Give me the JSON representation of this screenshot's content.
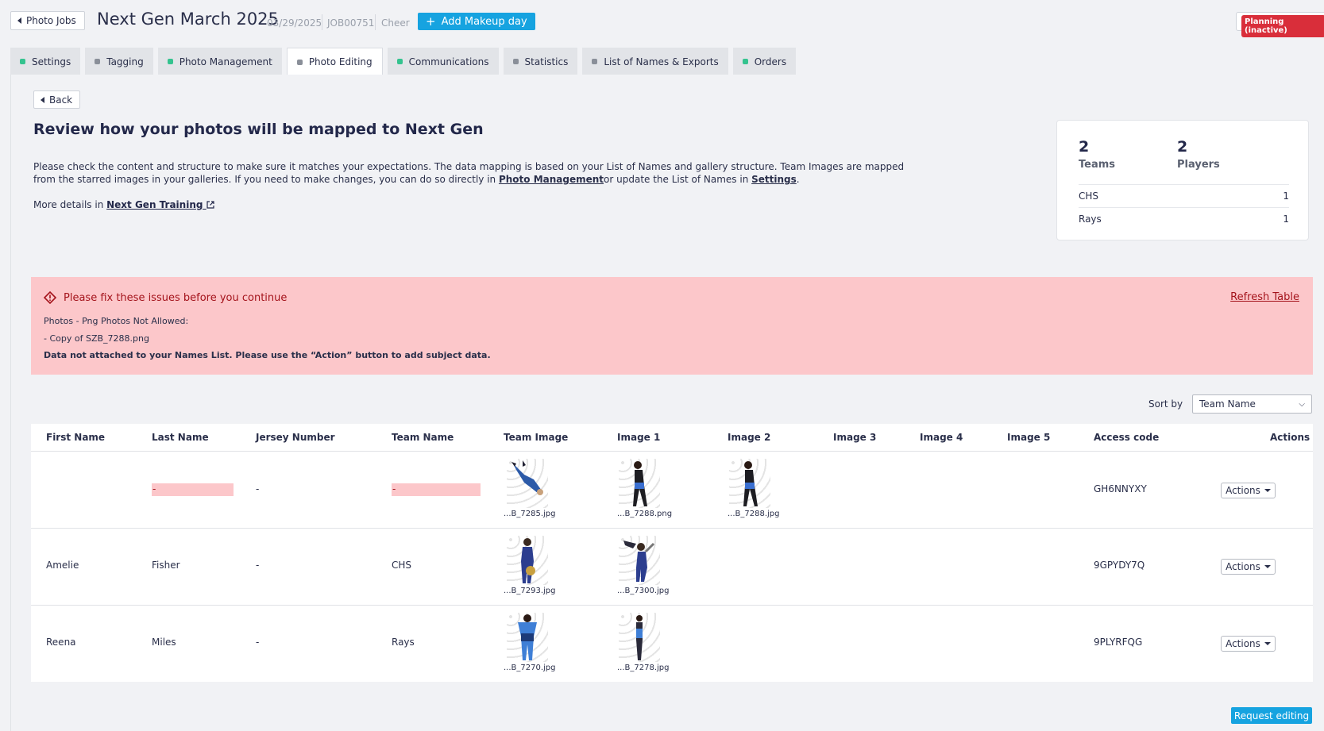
{
  "header": {
    "back_label": "Photo Jobs",
    "title": "Next Gen March 2025",
    "date": "03/29/2025",
    "job_id": "JOB00751",
    "job_type": "Cheer",
    "add_makeup_label": "Add Makeup day",
    "status": "Planning (inactive)"
  },
  "tabs": [
    {
      "label": "Settings",
      "status": "green"
    },
    {
      "label": "Tagging",
      "status": "gray"
    },
    {
      "label": "Photo Management",
      "status": "green"
    },
    {
      "label": "Photo Editing",
      "status": "gray",
      "active": true
    },
    {
      "label": "Communications",
      "status": "green"
    },
    {
      "label": "Statistics",
      "status": "gray"
    },
    {
      "label": "List of Names & Exports",
      "status": "gray"
    },
    {
      "label": "Orders",
      "status": "green"
    }
  ],
  "main": {
    "back_label": "Back",
    "title": "Review how your photos will be mapped to Next Gen",
    "desc_part1": "Please check the content and structure to make sure it matches your expectations. The data mapping is based on your List of Names and gallery structure. Team Images are mapped from the starred images in your galleries. If you need to make changes, you can do so directly in ",
    "desc_link1": "Photo Management",
    "desc_part2": "or update the List of Names in ",
    "desc_link2": "Settings",
    "desc_part3": ".",
    "more_prefix": "More details in",
    "more_link": "Next Gen Training"
  },
  "stats": {
    "teams_count": "2",
    "teams_label": "Teams",
    "players_count": "2",
    "players_label": "Players",
    "rows": [
      {
        "team": "CHS",
        "count": "1"
      },
      {
        "team": "Rays",
        "count": "1"
      }
    ]
  },
  "alert": {
    "title": "Please fix these issues before you continue",
    "refresh": "Refresh Table",
    "line1": "Photos - Png Photos Not Allowed:",
    "line2": "- Copy of SZB_7288.png",
    "line3": "Data not attached to your Names List. Please use the “Action” button to add subject data."
  },
  "sort": {
    "label": "Sort by",
    "value": "Team Name"
  },
  "table": {
    "columns": [
      "First Name",
      "Last Name",
      "Jersey Number",
      "Team Name",
      "Team Image",
      "Image 1",
      "Image 2",
      "Image 3",
      "Image 4",
      "Image 5",
      "Access code",
      "Actions"
    ],
    "rows": [
      {
        "first": "",
        "last": "-",
        "jersey": "-",
        "team": "-",
        "team_img": "...B_7285.jpg",
        "img1": "...B_7288.png",
        "img2": "...B_7288.jpg",
        "code": "GH6NNYXY",
        "action": "Actions"
      },
      {
        "first": "Amelie",
        "last": "Fisher",
        "jersey": "-",
        "team": "CHS",
        "team_img": "...B_7293.jpg",
        "img1": "...B_7300.jpg",
        "img2": "",
        "code": "9GPYDY7Q",
        "action": "Actions"
      },
      {
        "first": "Reena",
        "last": "Miles",
        "jersey": "-",
        "team": "Rays",
        "team_img": "...B_7270.jpg",
        "img1": "...B_7278.jpg",
        "img2": "",
        "code": "9PLYRFQG",
        "action": "Actions"
      }
    ]
  },
  "footer": {
    "request_label": "Request editing"
  },
  "colors": {
    "accent": "#16a3e0",
    "danger": "#d92e3a",
    "alert_bg": "#fcc7ca",
    "status_green": "#34c38f",
    "status_gray": "#8a8f99"
  }
}
